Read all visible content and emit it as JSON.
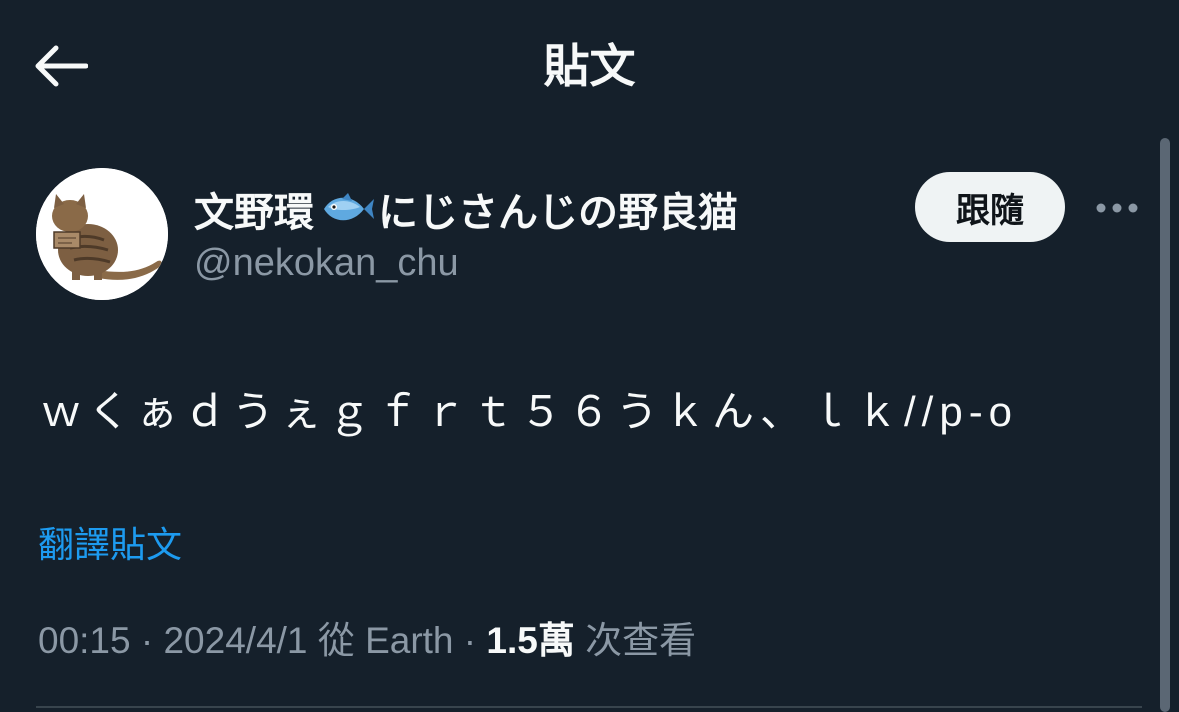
{
  "header": {
    "title": "貼文",
    "back_icon": "arrow-left-icon"
  },
  "author": {
    "avatar_icon": "cat-avatar",
    "name_part1": "文野環",
    "name_emoji": "fish-icon",
    "name_part2": "にじさんじの野良猫",
    "handle": "@nekokan_chu",
    "follow_label": "跟隨",
    "more_icon": "more-horizontal-icon"
  },
  "tweet": {
    "text": "ｗくぁｄうぇｇｆｒｔ５６うｋん、ｌｋ//p-o",
    "translate_label": "翻譯貼文",
    "time": "00:15",
    "date": "2024/4/1",
    "source": "從 Earth",
    "views_count": "1.5萬",
    "views_label": "次查看"
  },
  "colors": {
    "background": "#15202b",
    "text_primary": "#f7f9f9",
    "text_secondary": "#8b98a5",
    "accent": "#1d9bf0",
    "button_bg": "#eff3f4"
  }
}
